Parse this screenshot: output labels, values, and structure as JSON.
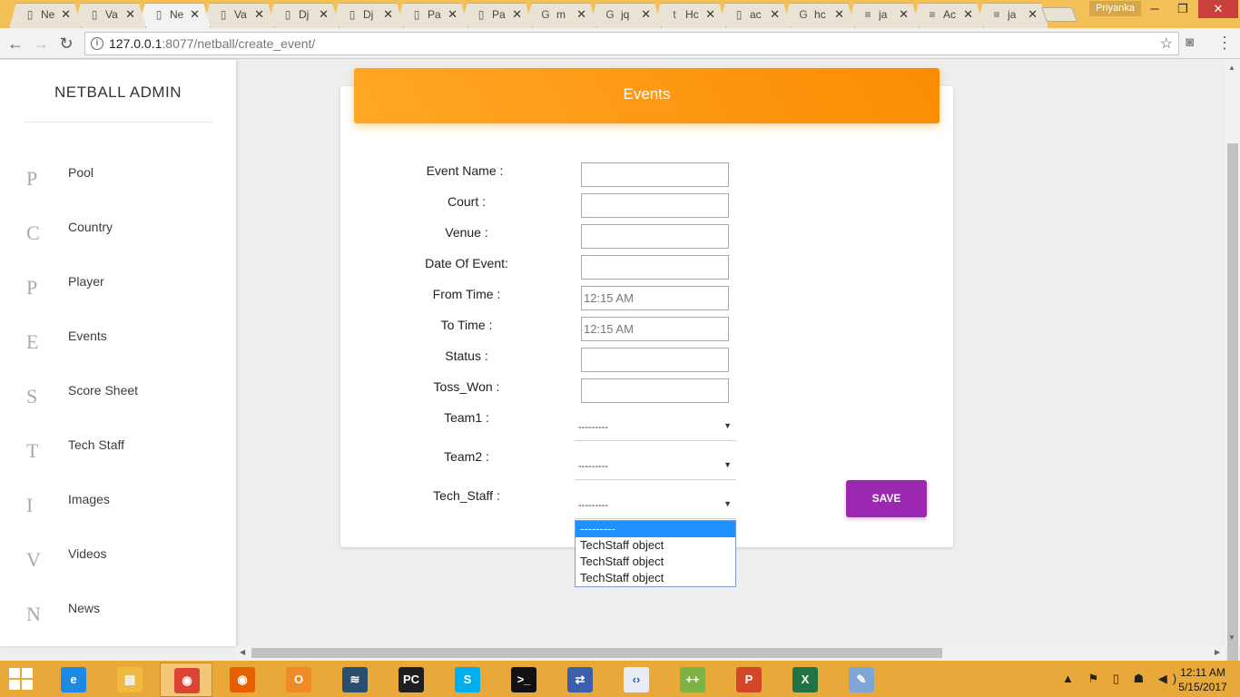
{
  "browser": {
    "tabs": [
      {
        "label": "Ne",
        "icon": "page-icon",
        "active": false
      },
      {
        "label": "Va",
        "icon": "page-icon",
        "active": false
      },
      {
        "label": "Ne",
        "icon": "page-icon",
        "active": true
      },
      {
        "label": "Va",
        "icon": "page-icon",
        "active": false
      },
      {
        "label": "Dj",
        "icon": "page-icon",
        "active": false
      },
      {
        "label": "Dj",
        "icon": "page-icon",
        "active": false
      },
      {
        "label": "Pa",
        "icon": "page-icon",
        "active": false
      },
      {
        "label": "Pa",
        "icon": "page-icon",
        "active": false
      },
      {
        "label": "m",
        "icon": "google-icon",
        "active": false
      },
      {
        "label": "jq",
        "icon": "google-icon",
        "active": false
      },
      {
        "label": "Hc",
        "icon": "tumblr-icon",
        "active": false
      },
      {
        "label": "ac",
        "icon": "page-icon",
        "active": false
      },
      {
        "label": "hc",
        "icon": "google-icon",
        "active": false
      },
      {
        "label": "ja",
        "icon": "stackoverflow-icon",
        "active": false
      },
      {
        "label": "Ac",
        "icon": "stackoverflow-icon",
        "active": false
      },
      {
        "label": "ja",
        "icon": "stackoverflow-icon",
        "active": false
      }
    ],
    "profile_name": "Priyanka",
    "url_host": "127.0.0.1",
    "url_rest": ":8077/netball/create_event/"
  },
  "sidebar": {
    "brand": "NETBALL ADMIN",
    "items": [
      {
        "letter": "P",
        "label": "Pool"
      },
      {
        "letter": "C",
        "label": "Country"
      },
      {
        "letter": "P",
        "label": "Player"
      },
      {
        "letter": "E",
        "label": "Events"
      },
      {
        "letter": "S",
        "label": "Score Sheet"
      },
      {
        "letter": "T",
        "label": "Tech Staff"
      },
      {
        "letter": "I",
        "label": "Images"
      },
      {
        "letter": "V",
        "label": "Videos"
      },
      {
        "letter": "N",
        "label": "News"
      }
    ]
  },
  "form": {
    "title": "Events",
    "fields": {
      "event_name": {
        "label": "Event Name :",
        "value": ""
      },
      "court": {
        "label": "Court :",
        "value": ""
      },
      "venue": {
        "label": "Venue :",
        "value": ""
      },
      "date_of_event": {
        "label": "Date Of Event:",
        "value": ""
      },
      "from_time": {
        "label": "From Time :",
        "value": "12:15 AM"
      },
      "to_time": {
        "label": "To Time :",
        "value": "12:15 AM"
      },
      "status": {
        "label": "Status :",
        "value": ""
      },
      "toss_won": {
        "label": "Toss_Won :",
        "value": ""
      }
    },
    "selects": {
      "team1": {
        "label": "Team1 :",
        "value": "---------"
      },
      "team2": {
        "label": "Team2 :",
        "value": "---------"
      },
      "tech_staff": {
        "label": "Tech_Staff :",
        "value": "---------"
      }
    },
    "tech_staff_options": [
      "---------",
      "TechStaff object",
      "TechStaff object",
      "TechStaff object"
    ],
    "save_label": "SAVE"
  },
  "taskbar": {
    "apps": [
      {
        "name": "internet-explorer-icon",
        "glyph": "e",
        "color": "#1e88e5"
      },
      {
        "name": "file-explorer-icon",
        "glyph": "▤",
        "color": "#f0b940"
      },
      {
        "name": "chrome-icon",
        "glyph": "◉",
        "color": "#db4437"
      },
      {
        "name": "firefox-icon",
        "glyph": "◉",
        "color": "#e66000"
      },
      {
        "name": "outlook-icon",
        "glyph": "O",
        "color": "#f08a24"
      },
      {
        "name": "mysql-workbench-icon",
        "glyph": "≋",
        "color": "#2a4f6e"
      },
      {
        "name": "pycharm-icon",
        "glyph": "PC",
        "color": "#1f1f1f"
      },
      {
        "name": "skype-icon",
        "glyph": "S",
        "color": "#00aff0"
      },
      {
        "name": "command-prompt-icon",
        "glyph": ">_",
        "color": "#111111"
      },
      {
        "name": "network-tool-icon",
        "glyph": "⇄",
        "color": "#3b5fa8"
      },
      {
        "name": "visual-studio-code-icon",
        "glyph": "‹›",
        "color": "#e9ecf3"
      },
      {
        "name": "notepad-plus-plus-icon",
        "glyph": "++",
        "color": "#7cb342"
      },
      {
        "name": "powerpoint-icon",
        "glyph": "P",
        "color": "#d24726"
      },
      {
        "name": "excel-icon",
        "glyph": "X",
        "color": "#217346"
      },
      {
        "name": "paint-icon",
        "glyph": "✎",
        "color": "#7ea7d8"
      }
    ],
    "time": "12:11 AM",
    "date": "5/15/2017"
  }
}
